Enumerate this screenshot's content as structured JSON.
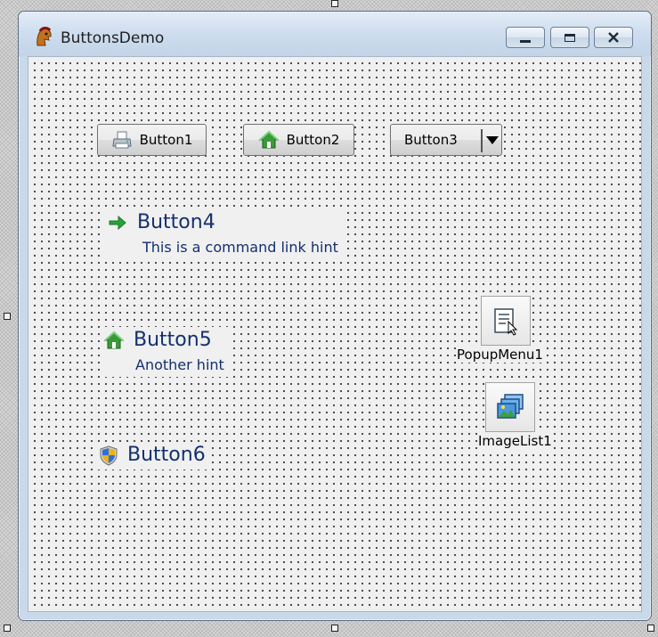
{
  "window": {
    "title": "ButtonsDemo"
  },
  "buttons": {
    "button1": {
      "label": "Button1",
      "icon": "printer-icon"
    },
    "button2": {
      "label": "Button2",
      "icon": "home-icon"
    },
    "button3": {
      "label": "Button3",
      "icon": "dropdown-arrow-icon"
    }
  },
  "command_links": [
    {
      "caption": "Button4",
      "hint": "This is a command link hint",
      "icon": "green-arrow-icon"
    },
    {
      "caption": "Button5",
      "hint": "Another hint",
      "icon": "home-icon"
    },
    {
      "caption": "Button6",
      "hint": "",
      "icon": "uac-shield-icon"
    }
  ],
  "components": {
    "popup_menu": {
      "label": "PopupMenu1",
      "icon": "popup-menu-icon"
    },
    "image_list": {
      "label": "ImageList1",
      "icon": "image-list-icon"
    }
  },
  "colors": {
    "command_link_text": "#13306e",
    "window_frame": "#c9d9ea",
    "form_background": "#f0f0f0"
  }
}
